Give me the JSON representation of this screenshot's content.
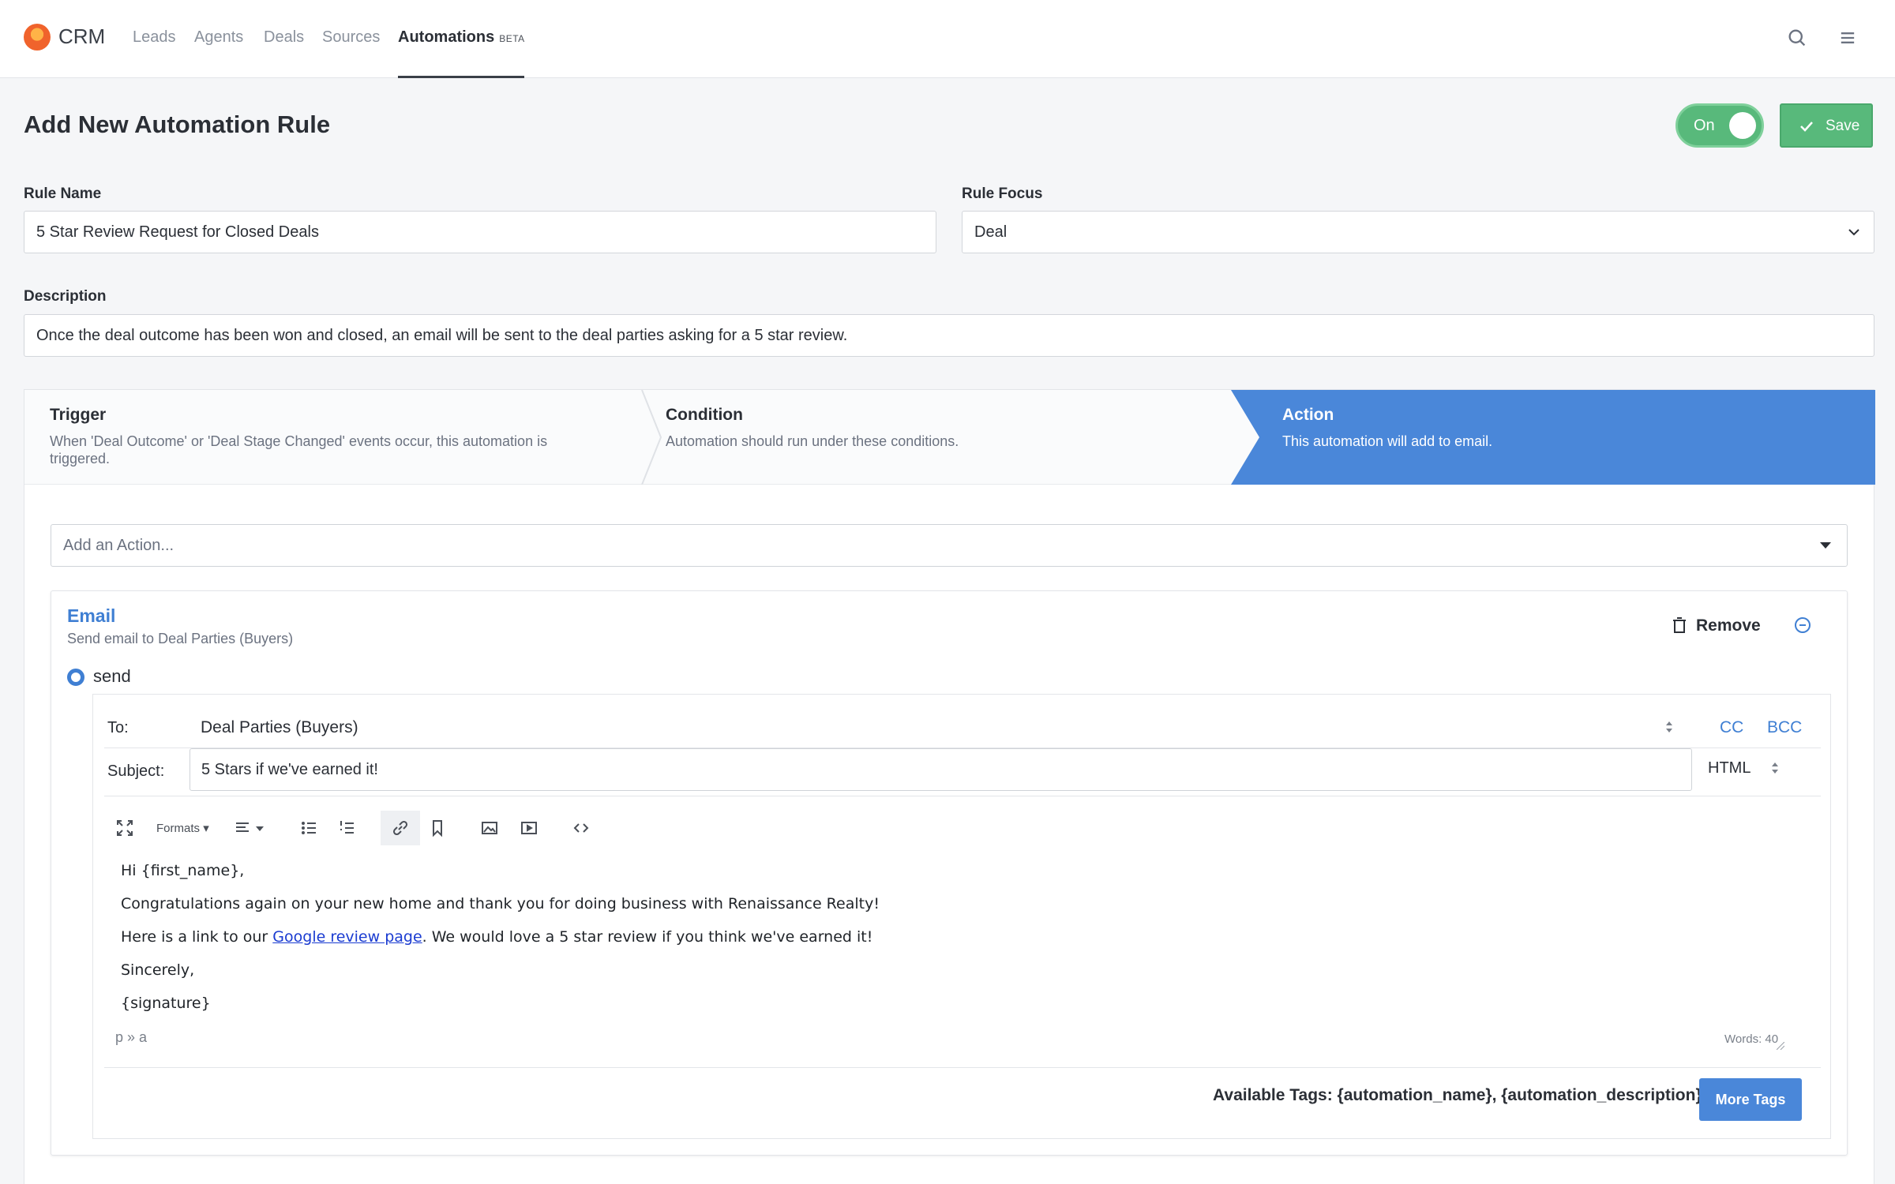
{
  "nav": {
    "brand": "CRM",
    "items": [
      {
        "label": "Leads"
      },
      {
        "label": "Agents"
      },
      {
        "label": "Deals"
      },
      {
        "label": "Sources"
      },
      {
        "label": "Automations",
        "badge": "BETA"
      }
    ],
    "icons": [
      "search-icon",
      "menu-icon"
    ]
  },
  "header": {
    "title": "Add New Automation Rule",
    "toggle_label": "On",
    "save_label": "Save"
  },
  "form": {
    "rule_name_label": "Rule Name",
    "rule_name_value": "5 Star Review Request for Closed Deals",
    "rule_focus_label": "Rule Focus",
    "rule_focus_value": "Deal",
    "description_label": "Description",
    "description_value": "Once the deal outcome has been won and closed, an email will be sent to the deal parties asking for a 5 star review."
  },
  "steps": [
    {
      "title": "Trigger",
      "desc_line1": "When 'Deal Outcome' or 'Deal Stage Changed' events occur, this automation is",
      "desc_line2": "triggered."
    },
    {
      "title": "Condition",
      "desc_line1": "Automation should run under these conditions."
    },
    {
      "title": "Action",
      "desc_line1": "This automation will add to email."
    }
  ],
  "action": {
    "select_placeholder": "Add an Action...",
    "email": {
      "title": "Email",
      "subtitle": "Send email to Deal Parties (Buyers)",
      "remove_label": "Remove",
      "radio_label": "send",
      "to_label": "To:",
      "to_value": "Deal Parties (Buyers)",
      "cc_label": "CC",
      "bcc_label": "BCC",
      "subject_label": "Subject:",
      "subject_value": "5 Stars if we've earned it!",
      "format_value": "HTML",
      "toolbar": {
        "formats_label": "Formats"
      },
      "body": {
        "line1": "Hi {first_name},",
        "line2": "Congratulations again on your new home and thank you for doing business with Renaissance Realty!",
        "line3_before": "Here is a link to our ",
        "line3_link": "Google review page",
        "line3_after": ". We would love a 5 star review if you think we've earned it!",
        "line4": "Sincerely,",
        "line5": "{signature}"
      },
      "path": "p » a",
      "words": "Words: 40",
      "tags_text": "Available Tags: {automation_name}, {automation_description}",
      "more_tags_label": "More Tags"
    }
  },
  "colors": {
    "accent_blue": "#4a87d9",
    "link_blue": "#3f7fd3",
    "success_green": "#58b97b"
  }
}
